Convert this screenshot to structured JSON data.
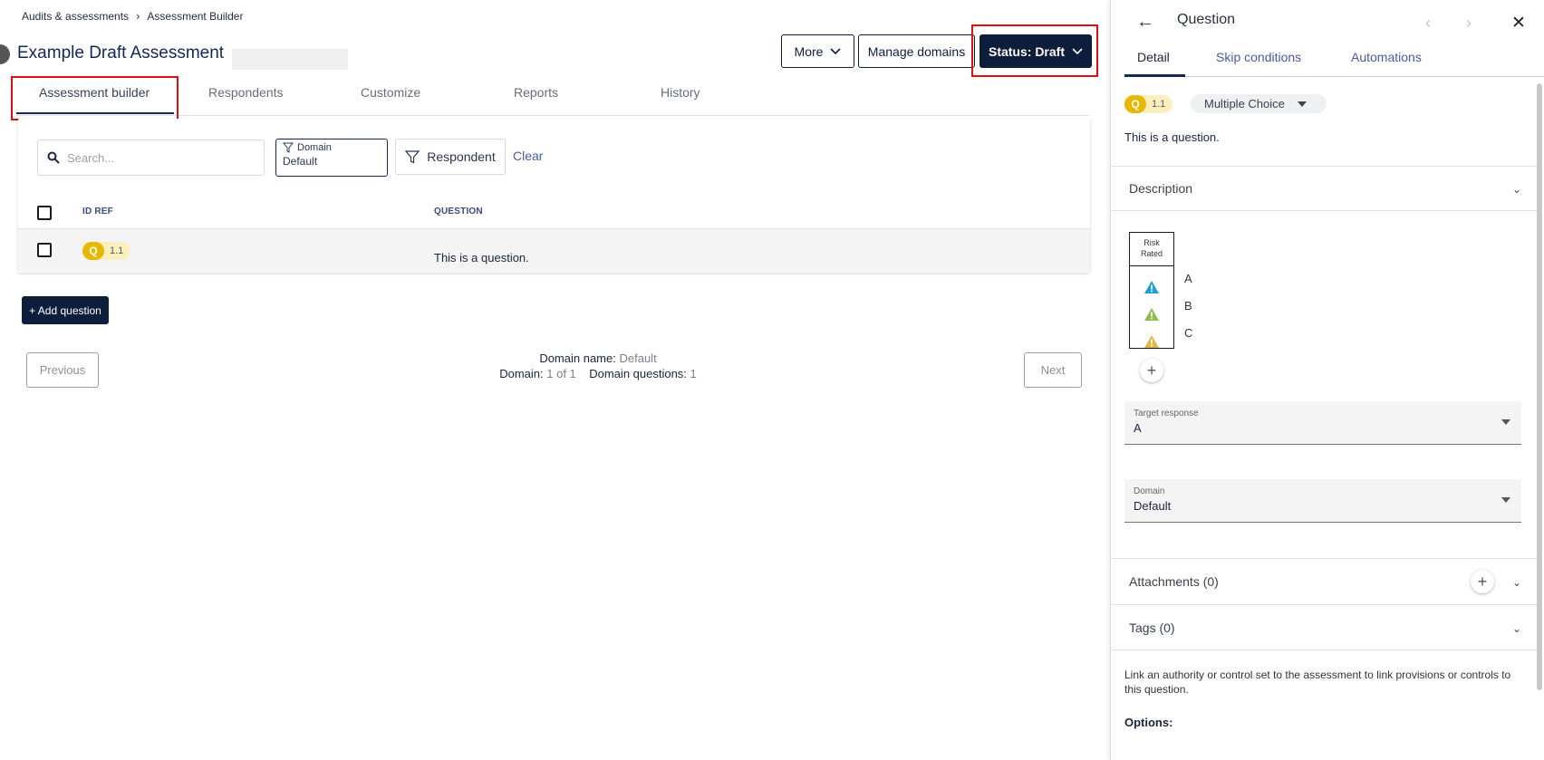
{
  "breadcrumb": {
    "root": "Audits & assessments",
    "current": "Assessment Builder"
  },
  "page": {
    "title": "Example Draft Assessment"
  },
  "header_buttons": {
    "more": "More",
    "manage_domains": "Manage domains",
    "status": "Status: Draft"
  },
  "tabs": [
    "Assessment builder",
    "Respondents",
    "Customize",
    "Reports",
    "History"
  ],
  "filters": {
    "search_placeholder": "Search...",
    "domain_label": "Domain",
    "domain_value": "Default",
    "respondent_label": "Respondent",
    "clear": "Clear"
  },
  "table": {
    "headers": {
      "id_ref": "ID REF",
      "question": "QUESTION"
    },
    "rows": [
      {
        "badge": "Q",
        "id": "1.1",
        "question": "This is a question."
      }
    ]
  },
  "add_question": "+ Add question",
  "pager": {
    "previous": "Previous",
    "next": "Next",
    "domain_name_label": "Domain name:",
    "domain_name_value": "Default",
    "domain_label": "Domain:",
    "domain_value": "1 of 1",
    "domain_questions_label": "Domain questions:",
    "domain_questions_value": "1"
  },
  "panel": {
    "title": "Question",
    "tabs": [
      "Detail",
      "Skip conditions",
      "Automations"
    ],
    "badge": "Q",
    "id": "1.1",
    "type": "Multiple Choice",
    "question": "This is a question.",
    "description": "Description",
    "risk_header_line1": "Risk",
    "risk_header_line2": "Rated",
    "answers": [
      {
        "label": "A",
        "color": "#1aa0d8"
      },
      {
        "label": "B",
        "color": "#8cbf4a"
      },
      {
        "label": "C",
        "color": "#e0b84a"
      }
    ],
    "target_response_label": "Target response",
    "target_response_value": "A",
    "domain_label": "Domain",
    "domain_value": "Default",
    "attachments": "Attachments (0)",
    "tags": "Tags (0)",
    "info": "Link an authority or control set to the assessment to link provisions or controls to this question.",
    "options": "Options:"
  }
}
